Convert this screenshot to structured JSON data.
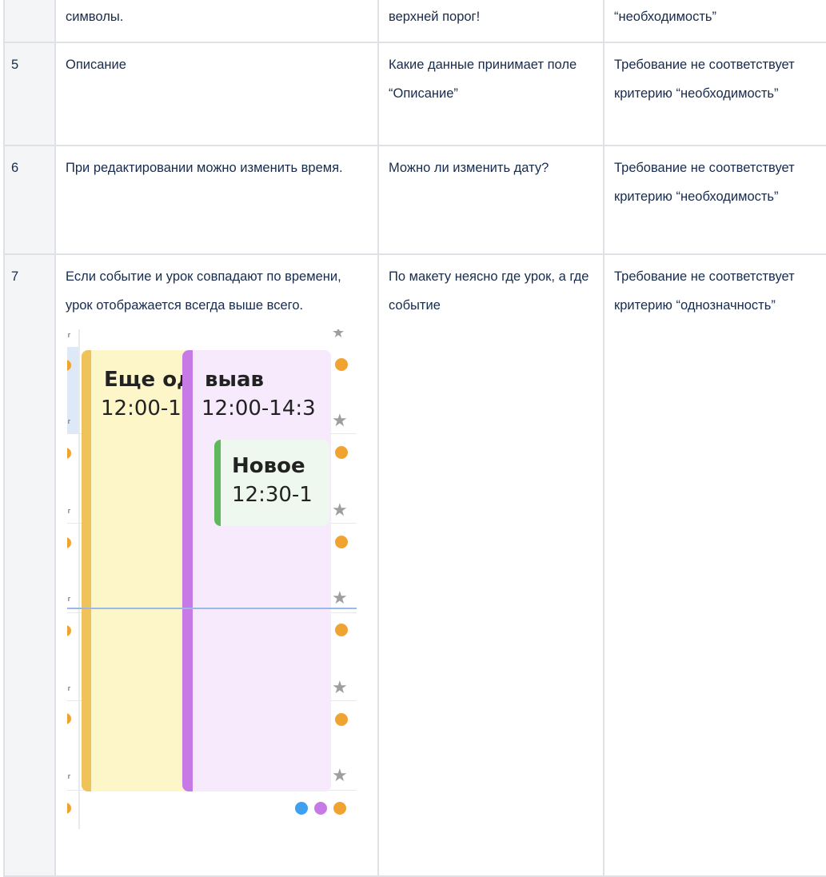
{
  "table": {
    "rows": [
      {
        "num": "",
        "requirement": "символы.",
        "question": "верхней порог!",
        "verdict": "“необходимость”"
      },
      {
        "num": "5",
        "requirement": "Описание",
        "question": "Какие данные принимает поле “Описание”",
        "verdict": "Требование не соответствует критерию “необходимость”"
      },
      {
        "num": "6",
        "requirement": "При редактировании можно изменить время.",
        "question": "Можно ли изменить дату?",
        "verdict": "Требование не соответствует критерию “необходимость”"
      },
      {
        "num": "7",
        "requirement": "Если событие и урок совпадают по времени, урок отображается всегда выше всего.",
        "question": "По макету неясно где урок, а где событие",
        "verdict": "Требование не соответствует критерию “однозначность”"
      }
    ]
  },
  "calendar": {
    "events": [
      {
        "title": "Еще од",
        "time": "12:00-1",
        "color": "#f0c35a",
        "bg": "#fdf6c8"
      },
      {
        "title": "выав",
        "time": "12:00-14:3",
        "color": "#c77ae6",
        "bg": "#f6eafc"
      },
      {
        "title": "Новое",
        "time": "12:30-1",
        "color": "#5fb85c",
        "bg": "#eef8ee"
      }
    ],
    "legend_dots": [
      "#3f9ff0",
      "#c77ae6",
      "#f1a332"
    ],
    "icons": {
      "slot_marker": "orange-dot-icon",
      "favorite": "star-icon"
    }
  }
}
